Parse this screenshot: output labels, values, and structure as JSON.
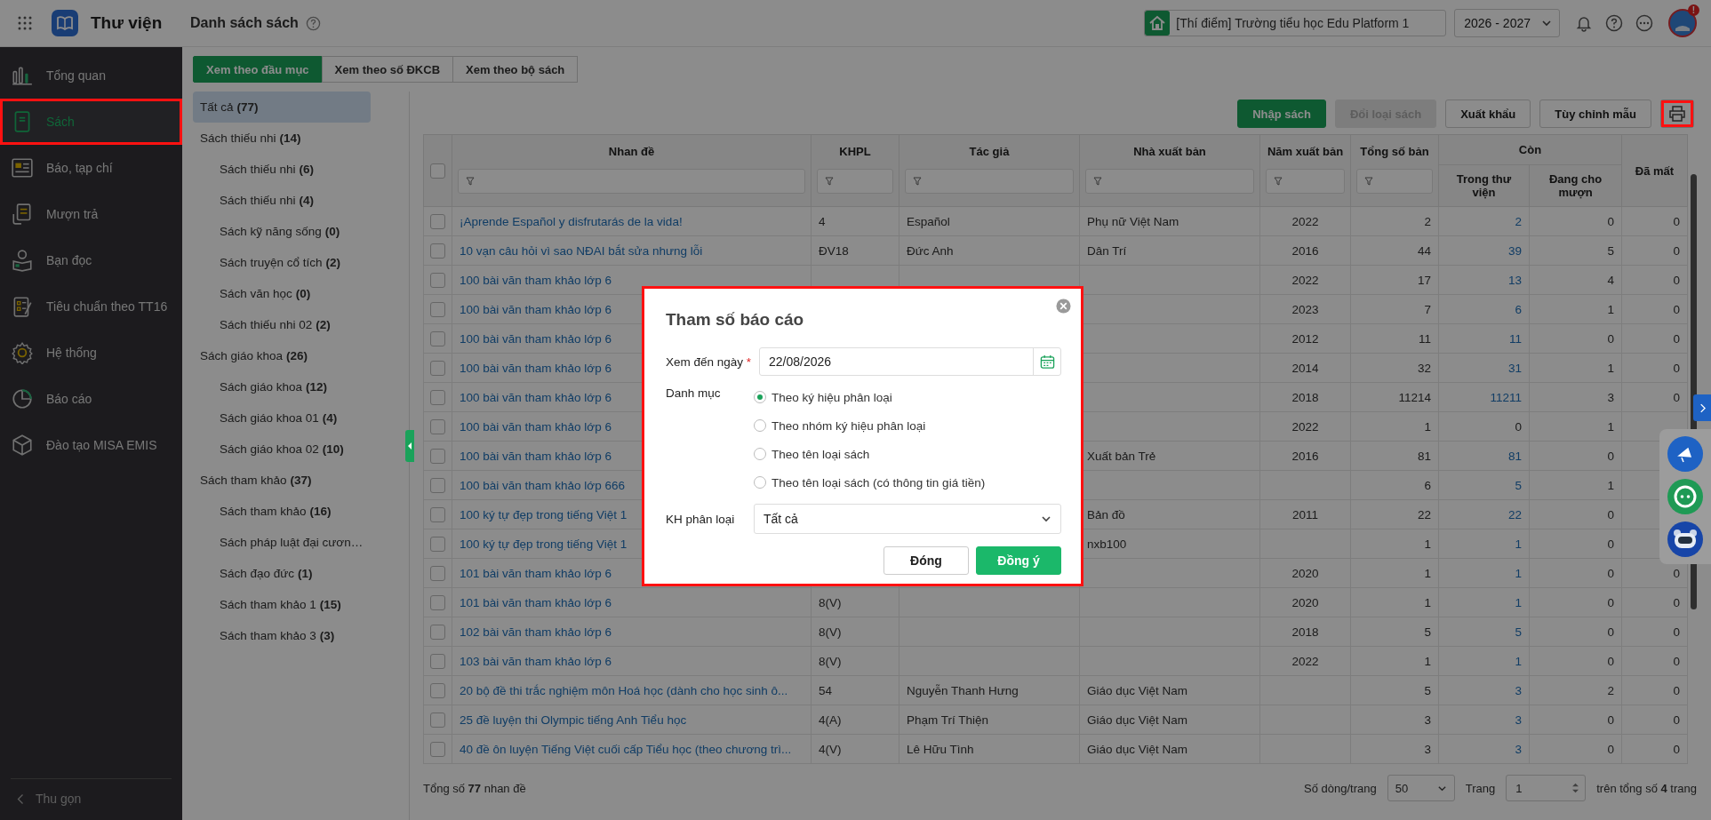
{
  "header": {
    "app_name": "Thư viện",
    "page_title": "Danh sách sách",
    "school": "[Thí điểm] Trường tiểu học Edu Platform 1",
    "school_year": "2026 - 2027",
    "notification_badge": "!"
  },
  "sidebar": {
    "items": [
      {
        "label": "Tổng quan",
        "selected": false,
        "highlighted": false
      },
      {
        "label": "Sách",
        "selected": true,
        "highlighted": true
      },
      {
        "label": "Báo, tạp chí",
        "selected": false,
        "highlighted": false
      },
      {
        "label": "Mượn trả",
        "selected": false,
        "highlighted": false
      },
      {
        "label": "Bạn đọc",
        "selected": false,
        "highlighted": false
      },
      {
        "label": "Tiêu chuẩn theo TT16",
        "selected": false,
        "highlighted": false
      },
      {
        "label": "Hệ thống",
        "selected": false,
        "highlighted": false
      },
      {
        "label": "Báo cáo",
        "selected": false,
        "highlighted": false
      },
      {
        "label": "Đào tạo MISA EMIS",
        "selected": false,
        "highlighted": false
      }
    ],
    "collapse_label": "Thu gọn"
  },
  "view_tabs": [
    {
      "label": "Xem theo đầu mục",
      "selected": true
    },
    {
      "label": "Xem theo số ĐKCB",
      "selected": false
    },
    {
      "label": "Xem theo bộ sách",
      "selected": false
    }
  ],
  "tree": [
    {
      "name": "Tất cả",
      "count": "(77)",
      "selected": true
    },
    {
      "name": "Sách thiếu nhi",
      "count": "(14)",
      "selected": false,
      "children": [
        {
          "name": "Sách thiếu nhi",
          "count": "(6)",
          "selected": false
        },
        {
          "name": "Sách thiếu nhi",
          "count": "(4)",
          "selected": false
        },
        {
          "name": "Sách kỹ năng sống",
          "count": "(0)",
          "selected": false
        },
        {
          "name": "Sách truyện cổ tích",
          "count": "(2)",
          "selected": false
        },
        {
          "name": "Sách văn học",
          "count": "(0)",
          "selected": false
        },
        {
          "name": "Sách thiếu nhi 02",
          "count": "(2)",
          "selected": false
        }
      ]
    },
    {
      "name": "Sách giáo khoa",
      "count": "(26)",
      "selected": false,
      "children": [
        {
          "name": "Sách giáo khoa",
          "count": "(12)",
          "selected": false
        },
        {
          "name": "Sách giáo khoa 01",
          "count": "(4)",
          "selected": false
        },
        {
          "name": "Sách giáo khoa 02",
          "count": "(10)",
          "selected": false
        }
      ]
    },
    {
      "name": "Sách tham khảo",
      "count": "(37)",
      "selected": false,
      "children": [
        {
          "name": "Sách tham khảo",
          "count": "(16)",
          "selected": false
        },
        {
          "name": "Sách pháp luật đại cươn…",
          "selected": false
        },
        {
          "name": "Sách đạo đức",
          "count": "(1)",
          "selected": false
        },
        {
          "name": "Sách tham khảo 1",
          "count": "(15)",
          "selected": false
        },
        {
          "name": "Sách tham khảo 3",
          "count": "(3)",
          "selected": false
        }
      ]
    }
  ],
  "toolbar": {
    "buttons": [
      {
        "label": "Nhập sách",
        "kind": "primary",
        "disabled": false
      },
      {
        "label": "Đổi loại sách",
        "kind": "default",
        "disabled": true
      },
      {
        "label": "Xuất khẩu",
        "kind": "default",
        "disabled": false
      },
      {
        "label": "Tùy chỉnh mẫu",
        "kind": "default",
        "disabled": false
      }
    ],
    "print_highlighted": true
  },
  "table": {
    "header_checked": false,
    "columns": [
      {
        "label": "Nhan đề",
        "filter": true
      },
      {
        "label": "KHPL",
        "filter": true
      },
      {
        "label": "Tác giả",
        "filter": true
      },
      {
        "label": "Nhà xuất bản",
        "filter": true
      },
      {
        "label": "Năm xuất bản",
        "filter": true
      },
      {
        "label": "Tổng số bản",
        "filter": true
      }
    ],
    "remaining": {
      "label": "Còn",
      "columns": [
        {
          "label": "Trong thư viện"
        },
        {
          "label": "Đang cho mượn"
        }
      ]
    },
    "lost_column": {
      "label": "Đã mất"
    },
    "rows": [
      {
        "checked": false,
        "title": "¡Aprende Español y disfrutarás de la vida!",
        "khpl": "4",
        "author": "Español",
        "publisher": "Phụ nữ Việt Nam",
        "year": "2022",
        "total": "2",
        "in_library": "2",
        "in_library_link": true,
        "on_loan": "0",
        "lost": "0"
      },
      {
        "checked": false,
        "title": "10 vạn câu hỏi vì sao NĐAI bắt sửa nhưng lỗi",
        "khpl": "ĐV18",
        "author": "Đức Anh",
        "publisher": "Dân Trí",
        "year": "2016",
        "total": "44",
        "in_library": "39",
        "in_library_link": true,
        "on_loan": "5",
        "lost": "0"
      },
      {
        "checked": false,
        "title": "100 bài văn tham khảo lớp 6",
        "year": "2022",
        "total": "17",
        "in_library": "13",
        "in_library_link": true,
        "on_loan": "4",
        "lost": "0"
      },
      {
        "checked": false,
        "title": "100 bài văn tham khảo lớp 6",
        "year": "2023",
        "total": "7",
        "in_library": "6",
        "in_library_link": true,
        "on_loan": "1",
        "lost": "0"
      },
      {
        "checked": false,
        "title": "100 bài văn tham khảo lớp 6",
        "year": "2012",
        "total": "11",
        "in_library": "11",
        "in_library_link": true,
        "on_loan": "0",
        "lost": "0"
      },
      {
        "checked": false,
        "title": "100 bài văn tham khảo lớp 6",
        "year": "2014",
        "total": "32",
        "in_library": "31",
        "in_library_link": true,
        "on_loan": "1",
        "lost": "0"
      },
      {
        "checked": false,
        "title": "100 bài văn tham khảo lớp 6",
        "year": "2018",
        "total": "11214",
        "in_library": "11211",
        "in_library_link": true,
        "on_loan": "3",
        "lost": "0"
      },
      {
        "checked": false,
        "title": "100 bài văn tham khảo lớp 6",
        "year": "2022",
        "total": "1",
        "in_library": "0",
        "in_library_link": false,
        "on_loan": "1"
      },
      {
        "checked": false,
        "title": "100 bài văn tham khảo lớp 6",
        "publisher": "Xuất bản Trẻ",
        "year": "2016",
        "total": "81",
        "in_library": "81",
        "in_library_link": true,
        "on_loan": "0"
      },
      {
        "checked": false,
        "title": "100 bài văn tham khảo lớp 666",
        "total": "6",
        "in_library": "5",
        "in_library_link": true,
        "on_loan": "1"
      },
      {
        "checked": false,
        "title": "100 ký tự đẹp trong tiếng Việt 1",
        "publisher": "Bản đồ",
        "year": "2011",
        "total": "22",
        "in_library": "22",
        "in_library_link": true,
        "on_loan": "0"
      },
      {
        "checked": false,
        "title": "100 ký tự đẹp trong tiếng Việt 1",
        "publisher": "nxb100",
        "total": "1",
        "in_library": "1",
        "in_library_link": true,
        "on_loan": "0"
      },
      {
        "checked": false,
        "title": "101 bài văn tham khảo lớp 6",
        "year": "2020",
        "total": "1",
        "in_library": "1",
        "in_library_link": true,
        "on_loan": "0",
        "lost": "0"
      },
      {
        "checked": false,
        "title": "101 bài văn tham khảo lớp 6",
        "khpl": "8(V)",
        "year": "2020",
        "total": "1",
        "in_library": "1",
        "in_library_link": true,
        "on_loan": "0",
        "lost": "0"
      },
      {
        "checked": false,
        "title": "102 bài văn tham khảo lớp 6",
        "khpl": "8(V)",
        "year": "2018",
        "total": "5",
        "in_library": "5",
        "in_library_link": true,
        "on_loan": "0",
        "lost": "0"
      },
      {
        "checked": false,
        "title": "103 bài văn tham khảo lớp 6",
        "khpl": "8(V)",
        "year": "2022",
        "total": "1",
        "in_library": "1",
        "in_library_link": true,
        "on_loan": "0",
        "lost": "0"
      },
      {
        "checked": false,
        "title": "20 bộ đề thi trắc nghiệm môn Hoá học (dành cho học sinh ô...",
        "khpl": "54",
        "author": "Nguyễn Thanh Hưng",
        "publisher": "Giáo dục Việt Nam",
        "total": "5",
        "in_library": "3",
        "in_library_link": true,
        "on_loan": "2",
        "lost": "0"
      },
      {
        "checked": false,
        "title": "25 đề luyện thi Olympic tiếng Anh Tiểu học",
        "khpl": "4(A)",
        "author": "Phạm Trí Thiện",
        "publisher": "Giáo dục Việt Nam",
        "total": "3",
        "in_library": "3",
        "in_library_link": true,
        "on_loan": "0",
        "lost": "0"
      },
      {
        "checked": false,
        "title": "40 đề ôn luyện Tiếng Việt cuối cấp Tiểu học (theo chương trì...",
        "khpl": "4(V)",
        "author": "Lê Hữu Tình",
        "publisher": "Giáo dục Việt Nam",
        "total": "3",
        "in_library": "3",
        "in_library_link": true,
        "on_loan": "0",
        "lost": "0"
      }
    ]
  },
  "footer": {
    "total": "Tổng số **77** nhan đề",
    "page_size_label": "Số dòng/trang",
    "page_size": "50",
    "page_label": "Trang",
    "page": "1",
    "page_total": "trên tổng số **4** trang"
  },
  "modal": {
    "title": "Tham số báo cáo",
    "highlighted": true,
    "date_label": "Xem đến ngày",
    "required_mark": "*",
    "date_value": "22/08/2026",
    "category_label": "Danh mục",
    "options": [
      {
        "label": "Theo ký hiệu phân loại",
        "selected": true
      },
      {
        "label": "Theo nhóm ký hiệu phân loại",
        "selected": false
      },
      {
        "label": "Theo tên loại sách",
        "selected": false
      },
      {
        "label": "Theo tên loại sách (có thông tin giá tiền)",
        "selected": false
      }
    ],
    "class_label": "KH phân loại",
    "class_value": "Tất cả",
    "buttons": [
      {
        "label": "Đóng",
        "kind": "default"
      },
      {
        "label": "Đồng ý",
        "kind": "primary"
      }
    ]
  }
}
